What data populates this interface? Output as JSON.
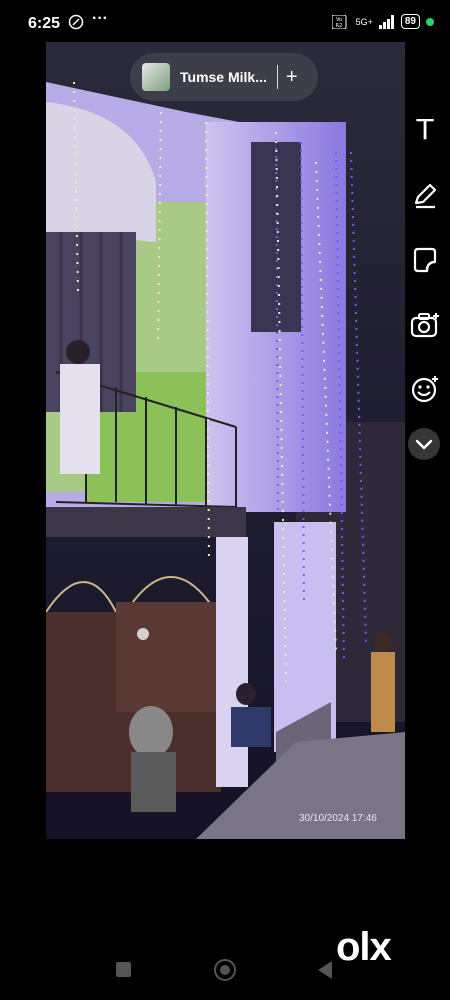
{
  "status_bar": {
    "time": "6:25",
    "network_label": "5G+",
    "battery": "89"
  },
  "story": {
    "title": "Tumse Milk...",
    "plus_label": "+"
  },
  "photo": {
    "timestamp": "30/10/2024  17:46"
  },
  "tools": {
    "text_label": "T",
    "items": [
      "text-tool",
      "pencil-tool",
      "sticker-tool",
      "camera-tool",
      "emoji-tool",
      "chevron-down"
    ]
  },
  "watermark": {
    "text": "olx"
  },
  "colors": {
    "background": "#000000",
    "accent_green": "#2bd46b",
    "lights_purple": "#8a6cff"
  }
}
